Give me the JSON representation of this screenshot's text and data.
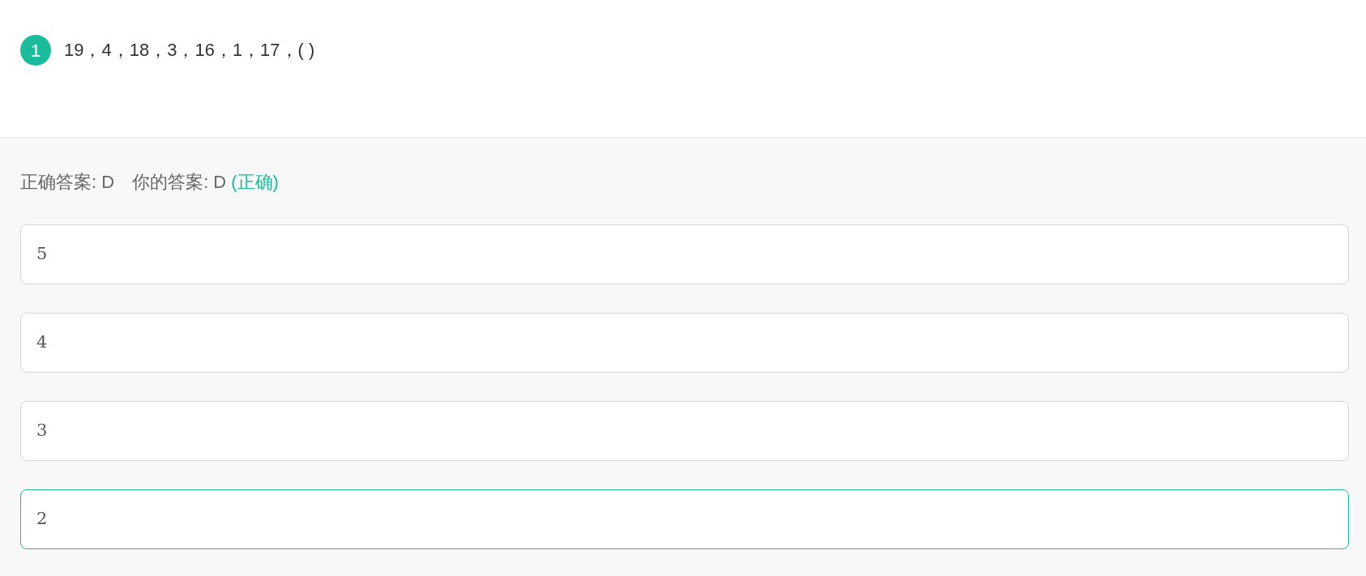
{
  "question": {
    "number": "1",
    "text": "19，4，18，3，16，1，17，( )"
  },
  "result": {
    "correct_answer": "正确答案: D",
    "your_answer": "你的答案: D",
    "verdict": "(正确)",
    "correct": true
  },
  "options": [
    {
      "text": "5",
      "selected": false
    },
    {
      "text": "4",
      "selected": false
    },
    {
      "text": "3",
      "selected": false
    },
    {
      "text": "2",
      "selected": true
    }
  ]
}
